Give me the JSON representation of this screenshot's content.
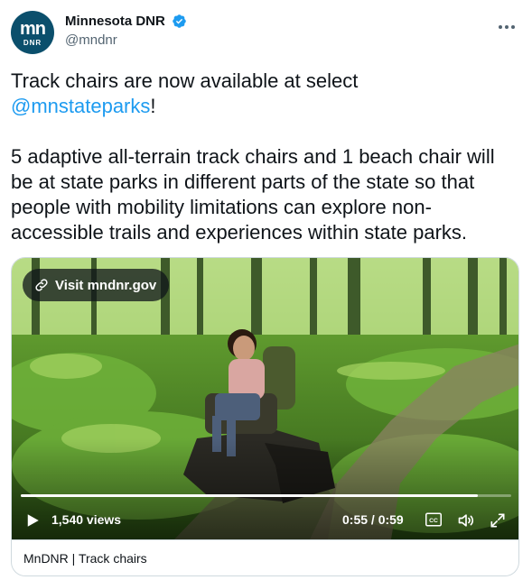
{
  "account": {
    "avatar_top_text": "mn",
    "avatar_sub_text": "DNR",
    "display_name": "Minnesota DNR",
    "handle": "@mndnr",
    "verified": true
  },
  "tweet": {
    "line1": "Track chairs are now available at select\n",
    "mention": "@mnstateparks",
    "after_mention": "!\n\n5 adaptive all-terrain track chairs and 1 beach chair will be at state parks in different parts of the state so that people with mobility limitations can explore non-accessible trails and experiences within state parks."
  },
  "media": {
    "link_label": "Visit mndnr.gov",
    "views": "1,540 views",
    "time": "0:55 / 0:59",
    "progress": 0.932,
    "card_title": "MnDNR | Track chairs"
  },
  "icons": {
    "more": "more-icon",
    "link": "link-icon",
    "play": "play-icon",
    "captions": "captions-icon",
    "volume": "volume-icon",
    "fullscreen": "fullscreen-icon",
    "verified": "verified-badge-icon"
  },
  "colors": {
    "mention": "#1d9bf0",
    "verified": "#1d9bf0",
    "avatar_bg": "#0b4f6c",
    "avatar_accent": "#7fc242",
    "border": "#cfd9de",
    "muted": "#536471"
  }
}
